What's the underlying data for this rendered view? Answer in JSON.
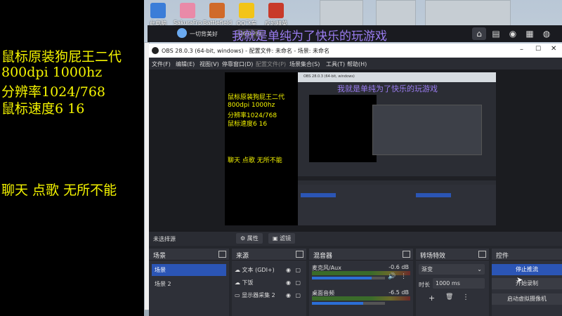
{
  "overlay": {
    "lines": [
      "鼠标原装狗屁王二代",
      "800dpi 1000hz",
      "分辨率1024/768",
      "鼠标速度6   16",
      "聊天 点歌 无所不能"
    ]
  },
  "desktop_icons": [
    {
      "label": "此电脑",
      "color": "#3b7dd8"
    },
    {
      "label": "SakuraFrp",
      "color": "#e98aa8"
    },
    {
      "label": "Battlefield",
      "color": "#d06a2a"
    },
    {
      "label": "QQ飞车",
      "color": "#f2c418"
    },
    {
      "label": "反恐精英",
      "color": "#c83a2a"
    }
  ],
  "stream_bar": {
    "title": "一切背美好",
    "bubble": "2601293",
    "banner": "我就是单纯为了快乐的玩游戏"
  },
  "obs": {
    "window_title": "OBS 28.0.3 (64-bit, windows) - 配置文件: 未命名 - 场景: 未命名",
    "menu": [
      "文件(F)",
      "编辑(E)",
      "视图(V)",
      "停靠窗口(D)",
      "配置文件(P)",
      "场景集合(S)",
      "工具(T)",
      "帮助(H)"
    ],
    "no_source": "未选择源",
    "properties": "属性",
    "filters": "滤镜",
    "scenes": {
      "title": "场景",
      "items": [
        "场景",
        "场景 2"
      ]
    },
    "sources": {
      "title": "来源",
      "items": [
        "文本 (GDI+)",
        "下饭",
        "显示器采集 2"
      ]
    },
    "mixer": {
      "title": "混音器",
      "tracks": [
        {
          "name": "麦克风/Aux",
          "db": "-0.6 dB",
          "level": 0.82
        },
        {
          "name": "桌面音频",
          "db": "-6.5 dB",
          "level": 0.7
        }
      ]
    },
    "transitions": {
      "title": "转场特效",
      "type": "渐变",
      "duration_label": "时长",
      "duration": "1000 ms"
    },
    "controls": {
      "title": "控件",
      "stop_stream": "停止推流",
      "start_record": "开始录制",
      "virtual_cam": "启动虚拟摄像机"
    }
  },
  "nested": {
    "title": "OBS 28.0.3 (64-bit, windows)",
    "banner": "我就是单纯为了快乐的玩游戏",
    "lines": [
      "鼠标原装狗屁王二代",
      "800dpi 1000hz",
      "分辨率1024/768",
      "鼠标速度6   16"
    ],
    "talk": "聊天 点歌 无所不能"
  },
  "colors": {
    "accent": "#2b55b5",
    "overlay_text": "#f4f400",
    "banner": "#9a7cf0"
  }
}
